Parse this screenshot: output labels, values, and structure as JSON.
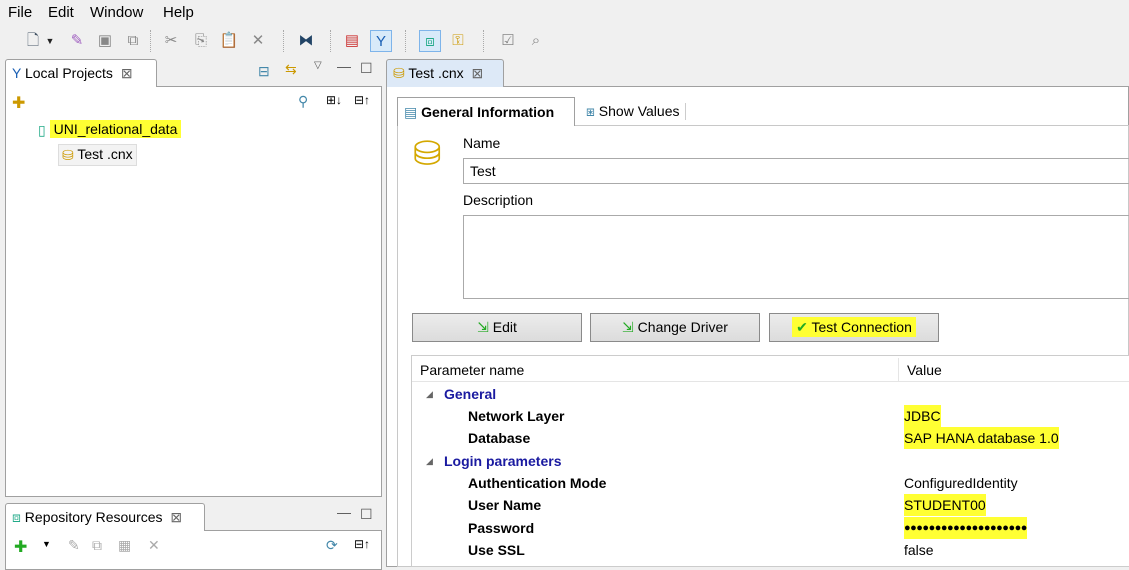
{
  "menu": [
    "File",
    "Edit",
    "Window",
    "Help"
  ],
  "left_panel": {
    "title": "Local Projects",
    "tree": {
      "project": "UNI_relational_data",
      "file": "Test .cnx"
    }
  },
  "repo_panel": {
    "title": "Repository Resources"
  },
  "editor": {
    "tab": "Test .cnx",
    "subtabs": [
      "General Information",
      "Show Values"
    ],
    "name_label": "Name",
    "name_value": "Test",
    "description_label": "Description",
    "description_value": "",
    "buttons": [
      "Edit",
      "Change Driver",
      "Test Connection"
    ],
    "table": {
      "headers": [
        "Parameter name",
        "Value"
      ],
      "groups": [
        {
          "name": "General",
          "rows": [
            {
              "k": "Network Layer",
              "v": "JDBC"
            },
            {
              "k": "Database",
              "v": "SAP HANA database 1.0"
            }
          ]
        },
        {
          "name": "Login parameters",
          "rows": [
            {
              "k": "Authentication Mode",
              "v": "ConfiguredIdentity"
            },
            {
              "k": "User Name",
              "v": "STUDENT00"
            },
            {
              "k": "Password",
              "v": "●●●●●●●●●●●●●●●●●●●●"
            },
            {
              "k": "Use SSL",
              "v": "false"
            }
          ]
        }
      ]
    }
  },
  "colors": {
    "highlight": "#ffff33",
    "group": "#1a1aa0"
  }
}
